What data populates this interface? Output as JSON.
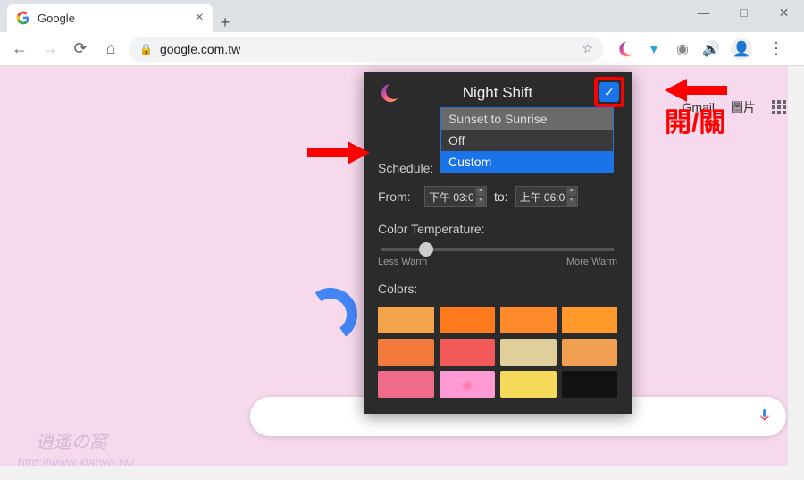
{
  "window": {
    "min": "—",
    "max": "□",
    "close": "✕"
  },
  "tab": {
    "title": "Google",
    "close": "×",
    "new": "+"
  },
  "addr": {
    "url": "google.com.tw"
  },
  "page": {
    "gmail": "Gmail",
    "images": "圖片",
    "watermark": "逍遙の窩",
    "watermark_url": "http://www.xiaoyo.tw/"
  },
  "popup": {
    "title": "Night Shift",
    "schedule_label": "Schedule:",
    "options": [
      "Sunset to Sunrise",
      "Off",
      "Custom"
    ],
    "from_label": "From:",
    "from_value": "下午 03:0",
    "to_label": "to:",
    "to_value": "上午 06:0",
    "ct_label": "Color Temperature:",
    "less_warm": "Less Warm",
    "more_warm": "More Warm",
    "colors_label": "Colors:",
    "swatches": [
      "#f5a34a",
      "#ff7a1a",
      "#ff8a2a",
      "#ff9a2a",
      "#f27a3a",
      "#f25a5a",
      "#e0cf9a",
      "#f0a050",
      "#f06a8a",
      "#ff9ad4",
      "#f5d95a",
      "#111111"
    ]
  },
  "anno": {
    "toggle_text": "開/關"
  }
}
